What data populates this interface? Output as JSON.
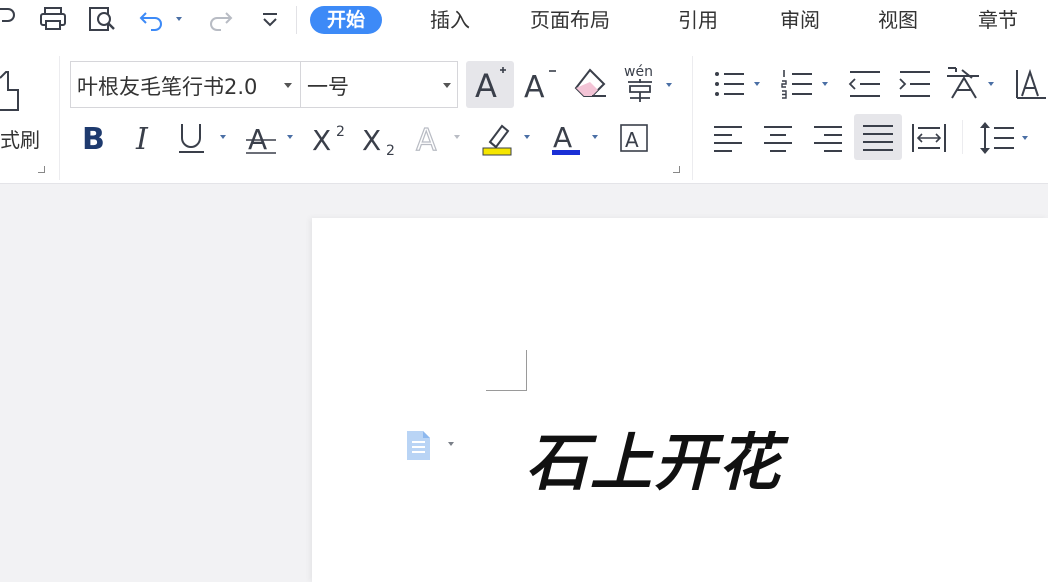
{
  "tabs": [
    {
      "label": "开始",
      "active": true
    },
    {
      "label": "插入"
    },
    {
      "label": "页面布局"
    },
    {
      "label": "引用"
    },
    {
      "label": "审阅"
    },
    {
      "label": "视图"
    },
    {
      "label": "章节"
    }
  ],
  "quick_access": [
    "save-icon",
    "print-icon",
    "print-preview-icon",
    "undo-icon",
    "redo-icon",
    "customize-chevron-icon"
  ],
  "ribbon": {
    "clipboard": {
      "format_painter_label": "式刷"
    },
    "font": {
      "font_name": "叶根友毛笔行书2.0",
      "font_size": "一号",
      "increase_size": "A",
      "decrease_size": "A",
      "pinyin_guide": "wén",
      "bold": "B",
      "italic": "I",
      "strikethrough": "A",
      "superscript": "X",
      "superscript_mark": "2",
      "subscript": "X",
      "subscript_mark": "2",
      "text_effect": "A",
      "font_color": "A",
      "char_border": "A"
    }
  },
  "colors": {
    "accent": "#3d8af7",
    "highlight": "#f5e600",
    "font_color_bar": "#1a2fd6",
    "icon": "#3a3f4a"
  },
  "document": {
    "text": "石上开花"
  }
}
